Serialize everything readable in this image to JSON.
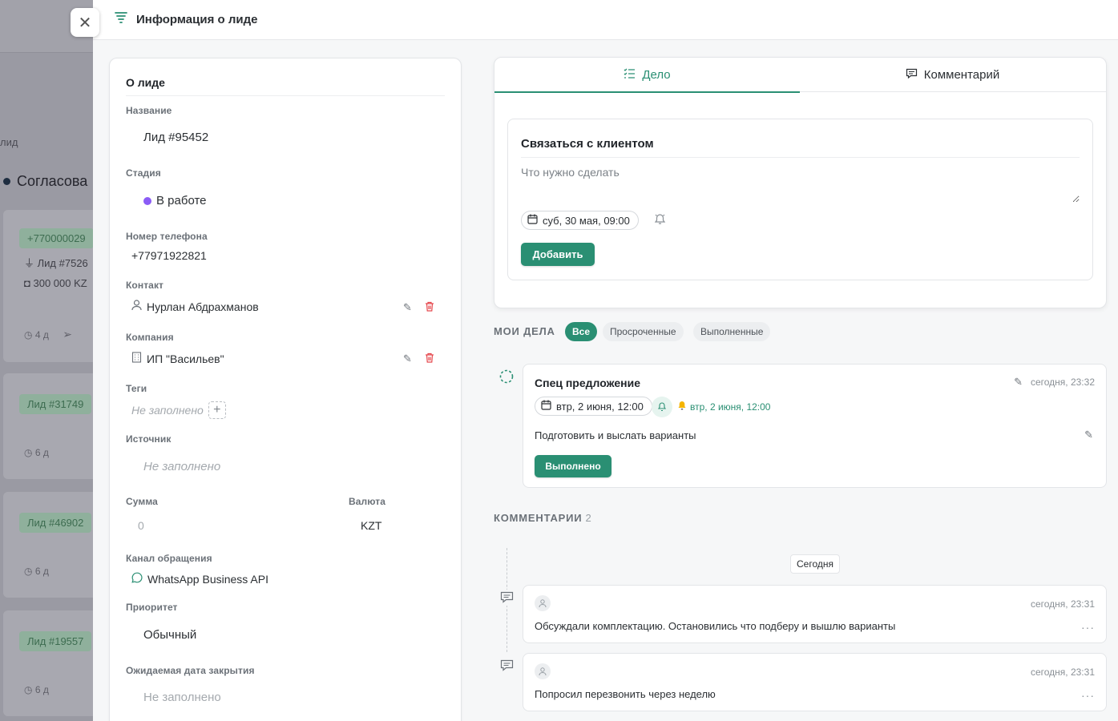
{
  "background": {
    "lid_label": "лид",
    "stage_name": "Согласова",
    "cards": [
      {
        "chip": "+770000029",
        "name": "Лид #7526",
        "amount": "300 000 KZ",
        "age": "4 д"
      },
      {
        "chip": "Лид #31749",
        "age": "6 д"
      },
      {
        "chip": "Лид #46902",
        "age": "6 д"
      },
      {
        "chip": "Лид #19557",
        "age": "6 д"
      }
    ]
  },
  "header": {
    "title": "Информация о лиде"
  },
  "lead": {
    "section_title": "О лиде",
    "name_label": "Название",
    "name_value": "Лид #95452",
    "stage_label": "Стадия",
    "stage_value": "В работе",
    "stage_color": "#8b5cf6",
    "phone_label": "Номер телефона",
    "phone_value": "+77971922821",
    "contact_label": "Контакт",
    "contact_value": "Нурлан Абдрахманов",
    "company_label": "Компания",
    "company_value": "ИП \"Васильев\"",
    "tags_label": "Теги",
    "tags_value": "Не заполнено",
    "source_label": "Источник",
    "source_value": "Не заполнено",
    "sum_label": "Сумма",
    "sum_value": "0",
    "currency_label": "Валюта",
    "currency_value": "KZT",
    "channel_label": "Канал обращения",
    "channel_value": "WhatsApp Business API",
    "priority_label": "Приоритет",
    "priority_value": "Обычный",
    "close_date_label": "Ожидаемая дата закрытия",
    "close_date_value": "Не заполнено"
  },
  "tabs": [
    {
      "label": "Дело",
      "icon": "list-check-icon",
      "active": true
    },
    {
      "label": "Комментарий",
      "icon": "comment-icon",
      "active": false
    }
  ],
  "task_form": {
    "title": "Связаться с клиентом",
    "desc_placeholder": "Что нужно сделать",
    "date": "суб, 30 мая, 09:00",
    "add_label": "Добавить"
  },
  "my_deals": {
    "title": "МОИ ДЕЛА",
    "filters": [
      "Все",
      "Просроченные",
      "Выполненные"
    ],
    "active_filter": "Все"
  },
  "deal": {
    "title": "Спец предложение",
    "time": "сегодня, 23:32",
    "date": "втр, 2 июня, 12:00",
    "reminder": "втр, 2 июня, 12:00",
    "description": "Подготовить и выслать варианты",
    "done_label": "Выполнено"
  },
  "comments": {
    "title": "КОММЕНТАРИИ",
    "count": "2",
    "day": "Сегодня",
    "items": [
      {
        "time": "сегодня, 23:31",
        "text": "Обсуждали комплектацию. Остановились что подберу и вышлю варианты"
      },
      {
        "time": "сегодня, 23:31",
        "text": "Попросил перезвонить через неделю"
      }
    ]
  },
  "colors": {
    "accent": "#2a8f73",
    "danger": "#e5484d"
  }
}
